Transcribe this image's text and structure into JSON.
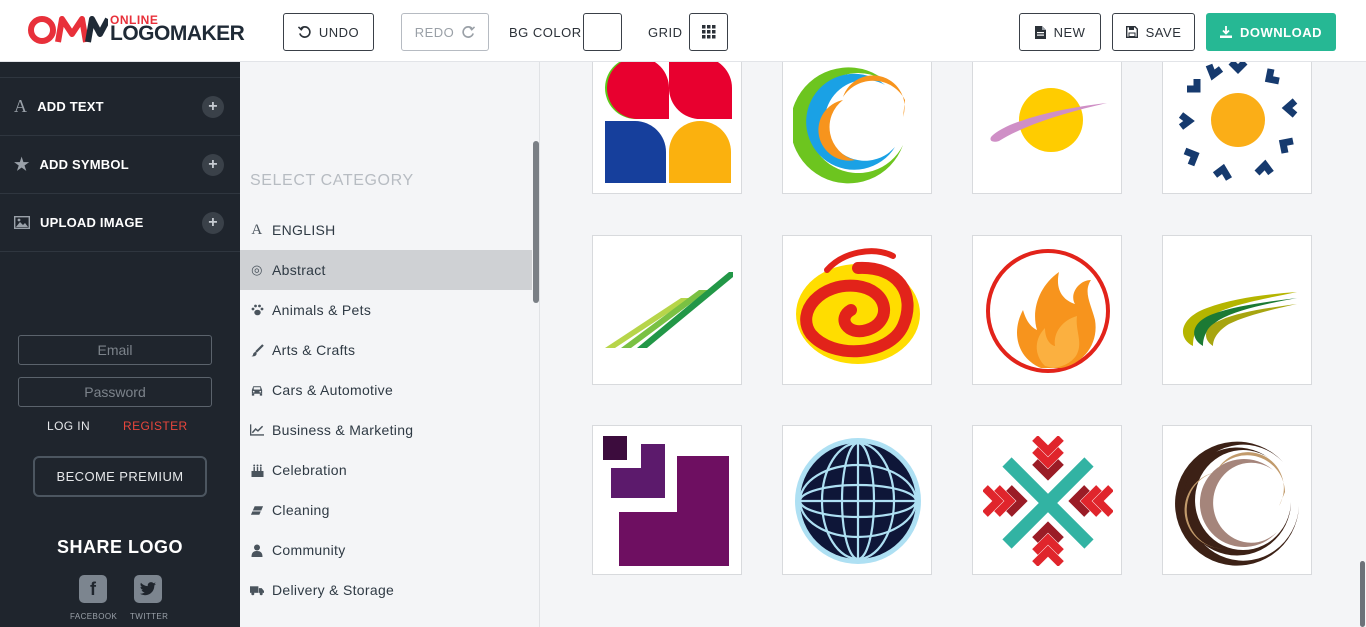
{
  "brand": {
    "online": "ONLINE",
    "name": "LOGOMAKER",
    "mark": "OM"
  },
  "toolbar": {
    "undo": "UNDO",
    "redo": "REDO",
    "bg_color": "BG COLOR",
    "grid": "GRID",
    "new": "NEW",
    "save": "SAVE",
    "download": "DOWNLOAD"
  },
  "sidebar": {
    "items": [
      {
        "label": "ADD TEXT",
        "icon": "font-icon"
      },
      {
        "label": "ADD SYMBOL",
        "icon": "star-icon"
      },
      {
        "label": "UPLOAD IMAGE",
        "icon": "image-icon"
      }
    ],
    "email_placeholder": "Email",
    "password_placeholder": "Password",
    "login": "LOG IN",
    "register": "REGISTER",
    "premium": "BECOME PREMIUM",
    "share_title": "SHARE LOGO",
    "facebook": "FACEBOOK",
    "twitter": "TWITTER"
  },
  "categories": {
    "title": "SELECT CATEGORY",
    "selected": "Abstract",
    "items": [
      {
        "label": "ENGLISH",
        "icon": "font-icon"
      },
      {
        "label": "Abstract",
        "icon": "target-icon"
      },
      {
        "label": "Animals & Pets",
        "icon": "paw-icon"
      },
      {
        "label": "Arts & Crafts",
        "icon": "brush-icon"
      },
      {
        "label": "Cars & Automotive",
        "icon": "car-icon"
      },
      {
        "label": "Business & Marketing",
        "icon": "line-chart-icon"
      },
      {
        "label": "Celebration",
        "icon": "cake-icon"
      },
      {
        "label": "Cleaning",
        "icon": "eraser-icon"
      },
      {
        "label": "Community",
        "icon": "user-icon"
      },
      {
        "label": "Delivery & Storage",
        "icon": "truck-icon"
      }
    ]
  },
  "colors": {
    "accent": "#26b894",
    "sidebar_bg": "#1f252d",
    "register": "#e8463c",
    "brand_red": "#e8303a"
  }
}
